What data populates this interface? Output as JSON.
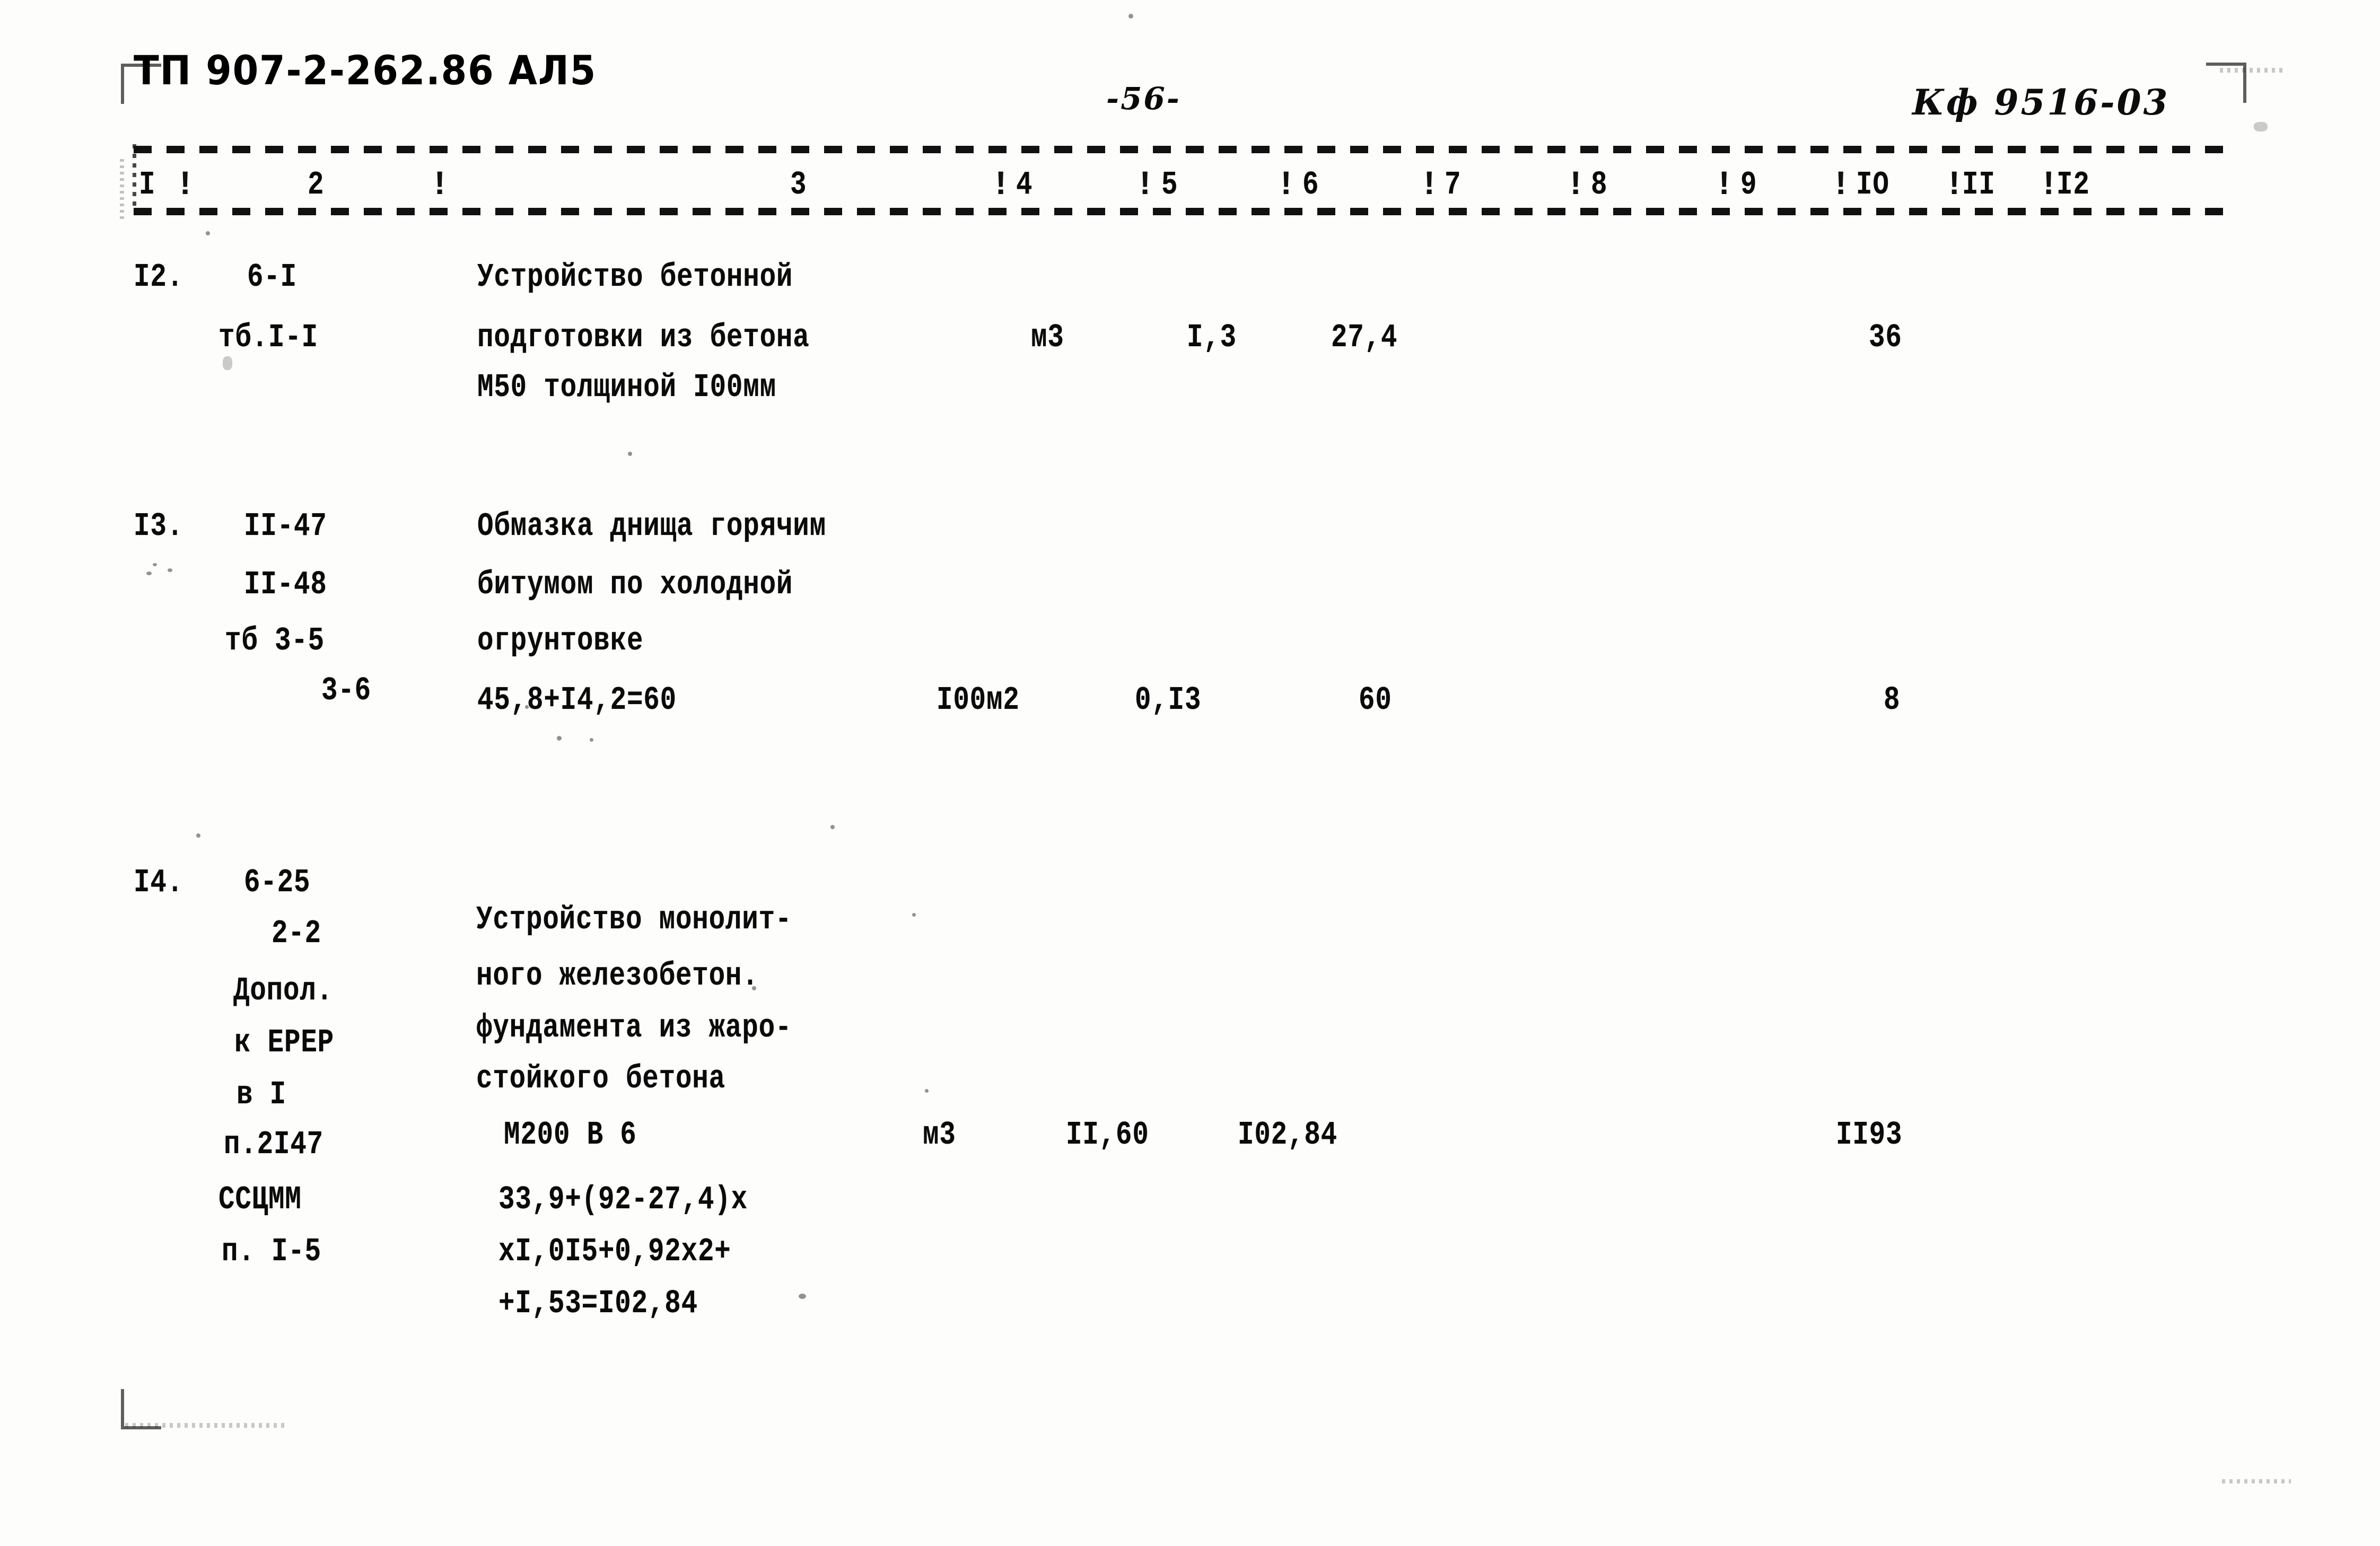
{
  "document": {
    "series_code": "ТП 907-2-262.86 АЛ5",
    "page_number": "-56-",
    "archive_stamp": "Кф 9516-03"
  },
  "table": {
    "column_headers": [
      "I",
      "2",
      "3",
      "4",
      "5",
      "6",
      "7",
      "8",
      "9",
      "IO",
      "II",
      "I2"
    ],
    "separator_glyph": "!",
    "rows": [
      {
        "num": "I2.",
        "codes": [
          "6-I",
          "тб.I-I"
        ],
        "description": [
          "Устройство бетонной",
          "подготовки из бетона",
          "М50 толщиной I00мм"
        ],
        "unit": "м3",
        "col5": "I,3",
        "col6": "27,4",
        "col9": "36"
      },
      {
        "num": "I3.",
        "codes": [
          "II-47",
          "II-48",
          "тб 3-5",
          "3-6"
        ],
        "description": [
          "Обмазка днища горячим",
          "битумом по холодной",
          "огрунтовке"
        ],
        "calc": "45,8+I4,2=60",
        "unit": "I00м2",
        "col5": "0,I3",
        "col6": "60",
        "col9": "8"
      },
      {
        "num": "I4.",
        "codes": [
          "6-25",
          "2-2",
          "Допол.",
          "к ЕРЕР",
          "в I",
          "п.2I47",
          "ССЦММ",
          "п. I-5"
        ],
        "description": [
          "Устройство монолит-",
          "ного железобетон.",
          "фундамента из жаро-",
          "стойкого бетона",
          "М200 В 6"
        ],
        "calc_lines": [
          "33,9+(92-27,4)х",
          "хI,0I5+0,92х2+",
          "+I,53=I02,84"
        ],
        "unit": "м3",
        "col5": "II,60",
        "col6": "I02,84",
        "col9": "II93"
      }
    ]
  }
}
